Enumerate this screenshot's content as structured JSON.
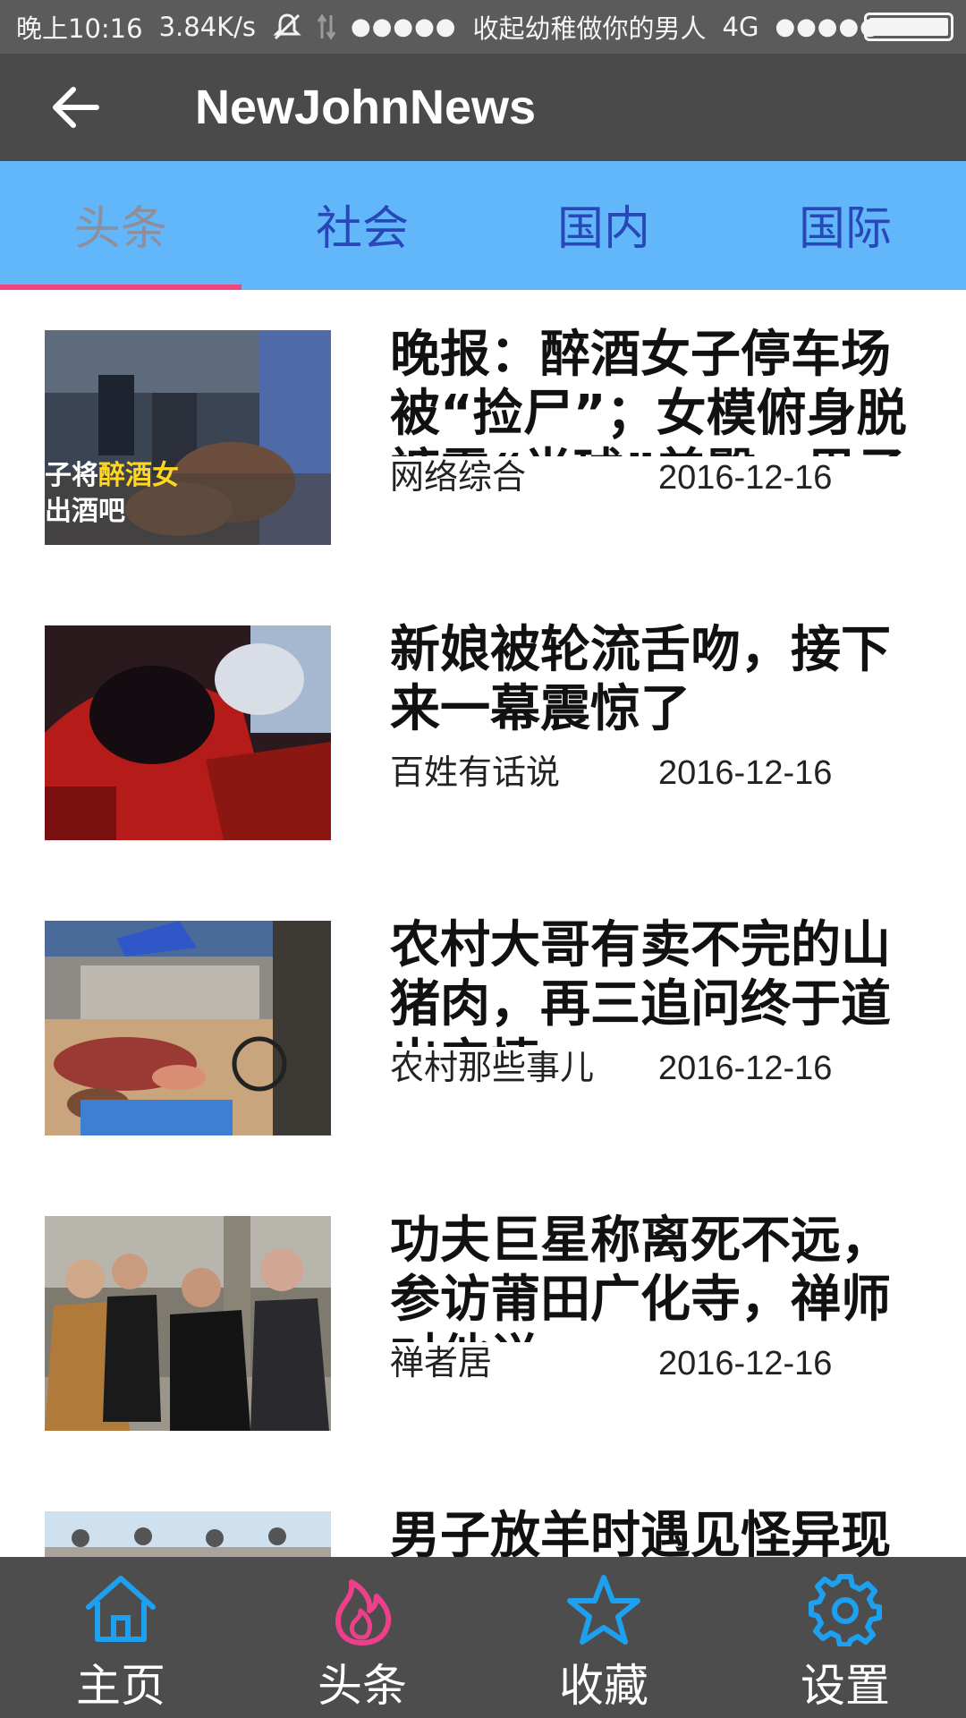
{
  "status_bar": {
    "time": "晚上10:16",
    "speed": "3.84K/s",
    "carrier1_signal": "●●●●●",
    "carrier_name": "收起幼稚做你的男人",
    "network": "4G",
    "carrier2_signal": "●●●●●",
    "icons": [
      "mute-icon",
      "data-arrows-icon",
      "battery-icon"
    ]
  },
  "toolbar": {
    "title": "NewJohnNews",
    "back_icon": "arrow-left-icon"
  },
  "tabs": [
    {
      "label": "头条",
      "active": true
    },
    {
      "label": "社会",
      "active": false
    },
    {
      "label": "国内",
      "active": false
    },
    {
      "label": "国际",
      "active": false
    }
  ],
  "news": [
    {
      "title": "晚报：醉酒女子停车场被“捡尸”；女模俯身脱裤露“半球”美臀；男子",
      "source": "网络综合",
      "date": "2016-12-16",
      "thumb_caption_1": "子将",
      "thumb_caption_hl": "醉酒女",
      "thumb_caption_2": "出酒吧"
    },
    {
      "title": "新娘被轮流舌吻，接下来一幕震惊了",
      "source": "百姓有话说",
      "date": "2016-12-16"
    },
    {
      "title": "农村大哥有卖不完的山猪肉，再三追问终于道出实情",
      "source": "农村那些事儿",
      "date": "2016-12-16"
    },
    {
      "title": "功夫巨星称离死不远，参访莆田广化寺，禅师对他说",
      "source": "禅者居",
      "date": "2016-12-16"
    },
    {
      "title": "男子放羊时遇见怪异现象",
      "source": "",
      "date": ""
    }
  ],
  "bottom_nav": [
    {
      "label": "主页",
      "icon": "home-icon",
      "color": "#1ea0f0"
    },
    {
      "label": "头条",
      "icon": "flame-icon",
      "color": "#ee3f8a"
    },
    {
      "label": "收藏",
      "icon": "star-icon",
      "color": "#1ea0f0"
    },
    {
      "label": "设置",
      "icon": "gear-icon",
      "color": "#1ea0f0"
    }
  ],
  "colors": {
    "status_bar": "#5b5b5b",
    "toolbar": "#4a4a4a",
    "tab_bar": "#62b6fa",
    "tab_text": "#2948b8",
    "tab_active_text": "#8d8f9a",
    "tab_indicator": "#f0467b",
    "bottom_nav": "#4d4d4d"
  }
}
